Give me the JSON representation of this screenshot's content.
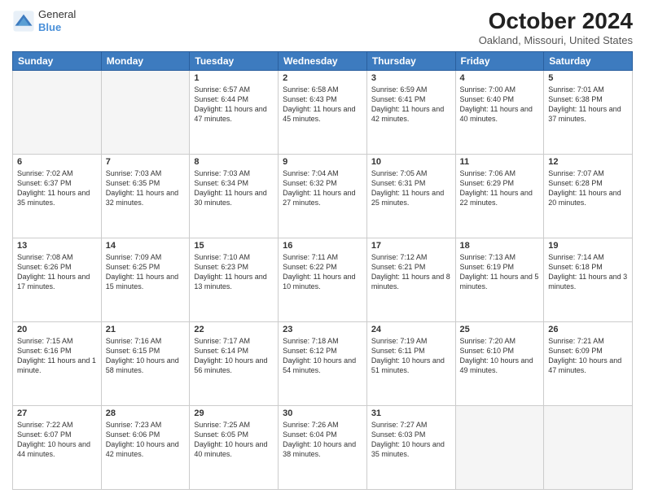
{
  "header": {
    "logo_general": "General",
    "logo_blue": "Blue",
    "month_title": "October 2024",
    "location": "Oakland, Missouri, United States"
  },
  "days_of_week": [
    "Sunday",
    "Monday",
    "Tuesday",
    "Wednesday",
    "Thursday",
    "Friday",
    "Saturday"
  ],
  "weeks": [
    [
      {
        "day": "",
        "empty": true
      },
      {
        "day": "",
        "empty": true
      },
      {
        "day": "1",
        "sunrise": "Sunrise: 6:57 AM",
        "sunset": "Sunset: 6:44 PM",
        "daylight": "Daylight: 11 hours and 47 minutes."
      },
      {
        "day": "2",
        "sunrise": "Sunrise: 6:58 AM",
        "sunset": "Sunset: 6:43 PM",
        "daylight": "Daylight: 11 hours and 45 minutes."
      },
      {
        "day": "3",
        "sunrise": "Sunrise: 6:59 AM",
        "sunset": "Sunset: 6:41 PM",
        "daylight": "Daylight: 11 hours and 42 minutes."
      },
      {
        "day": "4",
        "sunrise": "Sunrise: 7:00 AM",
        "sunset": "Sunset: 6:40 PM",
        "daylight": "Daylight: 11 hours and 40 minutes."
      },
      {
        "day": "5",
        "sunrise": "Sunrise: 7:01 AM",
        "sunset": "Sunset: 6:38 PM",
        "daylight": "Daylight: 11 hours and 37 minutes."
      }
    ],
    [
      {
        "day": "6",
        "sunrise": "Sunrise: 7:02 AM",
        "sunset": "Sunset: 6:37 PM",
        "daylight": "Daylight: 11 hours and 35 minutes."
      },
      {
        "day": "7",
        "sunrise": "Sunrise: 7:03 AM",
        "sunset": "Sunset: 6:35 PM",
        "daylight": "Daylight: 11 hours and 32 minutes."
      },
      {
        "day": "8",
        "sunrise": "Sunrise: 7:03 AM",
        "sunset": "Sunset: 6:34 PM",
        "daylight": "Daylight: 11 hours and 30 minutes."
      },
      {
        "day": "9",
        "sunrise": "Sunrise: 7:04 AM",
        "sunset": "Sunset: 6:32 PM",
        "daylight": "Daylight: 11 hours and 27 minutes."
      },
      {
        "day": "10",
        "sunrise": "Sunrise: 7:05 AM",
        "sunset": "Sunset: 6:31 PM",
        "daylight": "Daylight: 11 hours and 25 minutes."
      },
      {
        "day": "11",
        "sunrise": "Sunrise: 7:06 AM",
        "sunset": "Sunset: 6:29 PM",
        "daylight": "Daylight: 11 hours and 22 minutes."
      },
      {
        "day": "12",
        "sunrise": "Sunrise: 7:07 AM",
        "sunset": "Sunset: 6:28 PM",
        "daylight": "Daylight: 11 hours and 20 minutes."
      }
    ],
    [
      {
        "day": "13",
        "sunrise": "Sunrise: 7:08 AM",
        "sunset": "Sunset: 6:26 PM",
        "daylight": "Daylight: 11 hours and 17 minutes."
      },
      {
        "day": "14",
        "sunrise": "Sunrise: 7:09 AM",
        "sunset": "Sunset: 6:25 PM",
        "daylight": "Daylight: 11 hours and 15 minutes."
      },
      {
        "day": "15",
        "sunrise": "Sunrise: 7:10 AM",
        "sunset": "Sunset: 6:23 PM",
        "daylight": "Daylight: 11 hours and 13 minutes."
      },
      {
        "day": "16",
        "sunrise": "Sunrise: 7:11 AM",
        "sunset": "Sunset: 6:22 PM",
        "daylight": "Daylight: 11 hours and 10 minutes."
      },
      {
        "day": "17",
        "sunrise": "Sunrise: 7:12 AM",
        "sunset": "Sunset: 6:21 PM",
        "daylight": "Daylight: 11 hours and 8 minutes."
      },
      {
        "day": "18",
        "sunrise": "Sunrise: 7:13 AM",
        "sunset": "Sunset: 6:19 PM",
        "daylight": "Daylight: 11 hours and 5 minutes."
      },
      {
        "day": "19",
        "sunrise": "Sunrise: 7:14 AM",
        "sunset": "Sunset: 6:18 PM",
        "daylight": "Daylight: 11 hours and 3 minutes."
      }
    ],
    [
      {
        "day": "20",
        "sunrise": "Sunrise: 7:15 AM",
        "sunset": "Sunset: 6:16 PM",
        "daylight": "Daylight: 11 hours and 1 minute."
      },
      {
        "day": "21",
        "sunrise": "Sunrise: 7:16 AM",
        "sunset": "Sunset: 6:15 PM",
        "daylight": "Daylight: 10 hours and 58 minutes."
      },
      {
        "day": "22",
        "sunrise": "Sunrise: 7:17 AM",
        "sunset": "Sunset: 6:14 PM",
        "daylight": "Daylight: 10 hours and 56 minutes."
      },
      {
        "day": "23",
        "sunrise": "Sunrise: 7:18 AM",
        "sunset": "Sunset: 6:12 PM",
        "daylight": "Daylight: 10 hours and 54 minutes."
      },
      {
        "day": "24",
        "sunrise": "Sunrise: 7:19 AM",
        "sunset": "Sunset: 6:11 PM",
        "daylight": "Daylight: 10 hours and 51 minutes."
      },
      {
        "day": "25",
        "sunrise": "Sunrise: 7:20 AM",
        "sunset": "Sunset: 6:10 PM",
        "daylight": "Daylight: 10 hours and 49 minutes."
      },
      {
        "day": "26",
        "sunrise": "Sunrise: 7:21 AM",
        "sunset": "Sunset: 6:09 PM",
        "daylight": "Daylight: 10 hours and 47 minutes."
      }
    ],
    [
      {
        "day": "27",
        "sunrise": "Sunrise: 7:22 AM",
        "sunset": "Sunset: 6:07 PM",
        "daylight": "Daylight: 10 hours and 44 minutes."
      },
      {
        "day": "28",
        "sunrise": "Sunrise: 7:23 AM",
        "sunset": "Sunset: 6:06 PM",
        "daylight": "Daylight: 10 hours and 42 minutes."
      },
      {
        "day": "29",
        "sunrise": "Sunrise: 7:25 AM",
        "sunset": "Sunset: 6:05 PM",
        "daylight": "Daylight: 10 hours and 40 minutes."
      },
      {
        "day": "30",
        "sunrise": "Sunrise: 7:26 AM",
        "sunset": "Sunset: 6:04 PM",
        "daylight": "Daylight: 10 hours and 38 minutes."
      },
      {
        "day": "31",
        "sunrise": "Sunrise: 7:27 AM",
        "sunset": "Sunset: 6:03 PM",
        "daylight": "Daylight: 10 hours and 35 minutes."
      },
      {
        "day": "",
        "empty": true
      },
      {
        "day": "",
        "empty": true
      }
    ]
  ]
}
